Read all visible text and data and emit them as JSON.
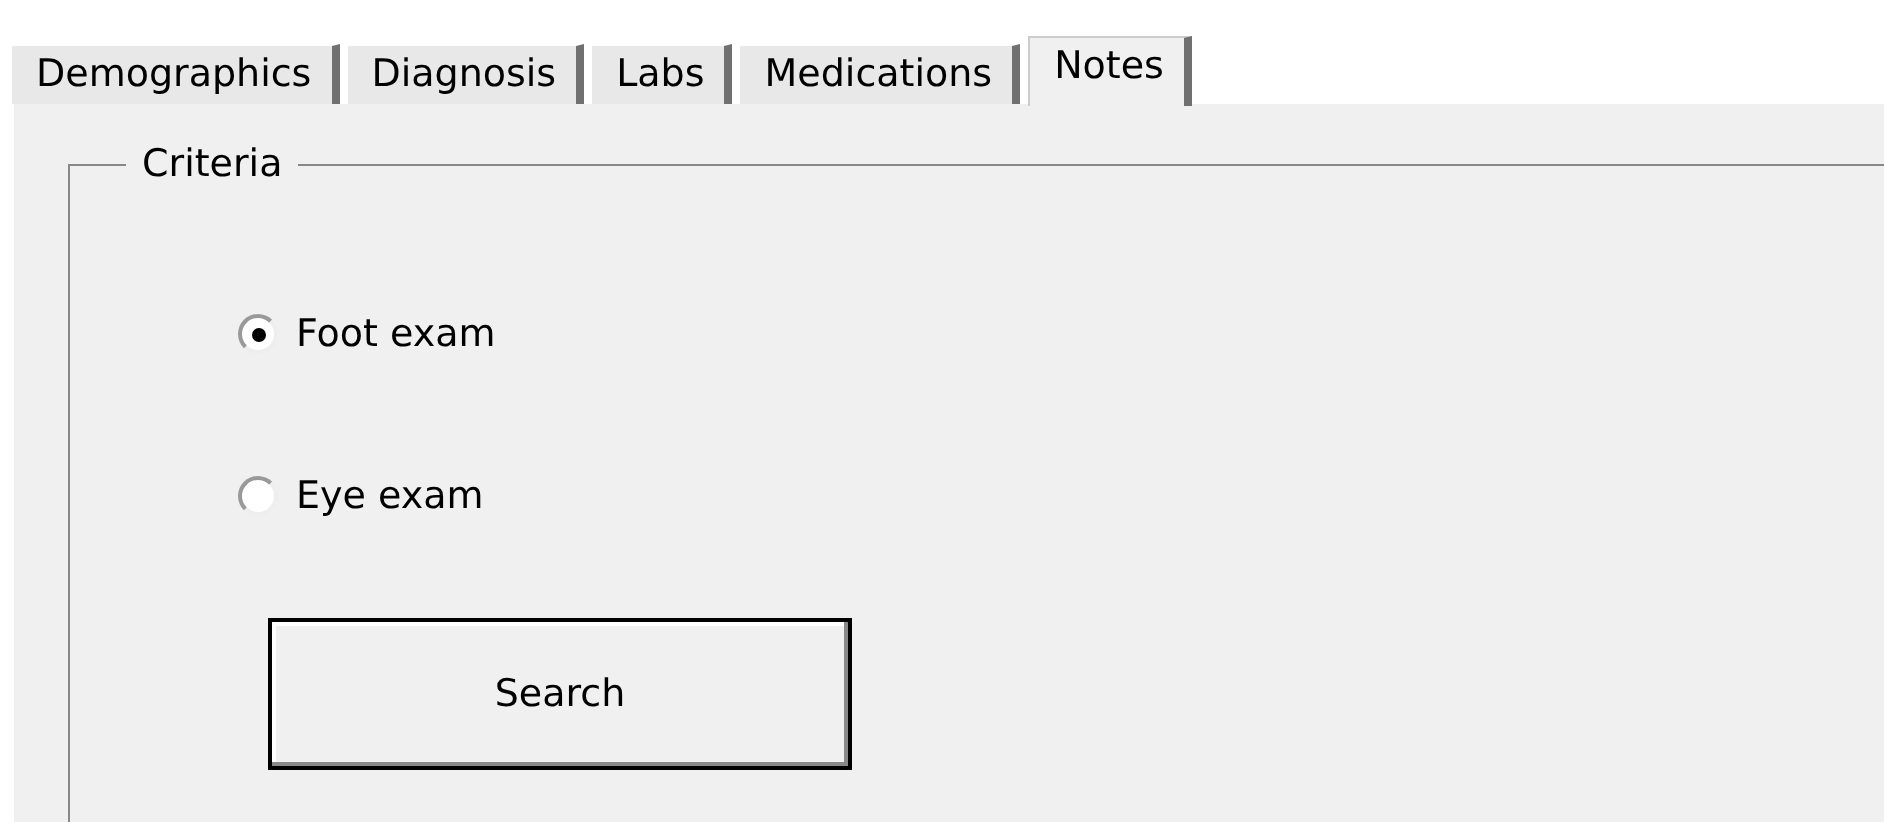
{
  "tabs": [
    {
      "label": "Demographics",
      "selected": false
    },
    {
      "label": "Diagnosis",
      "selected": false
    },
    {
      "label": "Labs",
      "selected": false
    },
    {
      "label": "Medications",
      "selected": false
    },
    {
      "label": "Notes",
      "selected": true
    }
  ],
  "group": {
    "title": "Criteria",
    "options": [
      {
        "label": "Foot exam",
        "selected": true
      },
      {
        "label": "Eye exam",
        "selected": false
      }
    ],
    "button": "Search"
  }
}
